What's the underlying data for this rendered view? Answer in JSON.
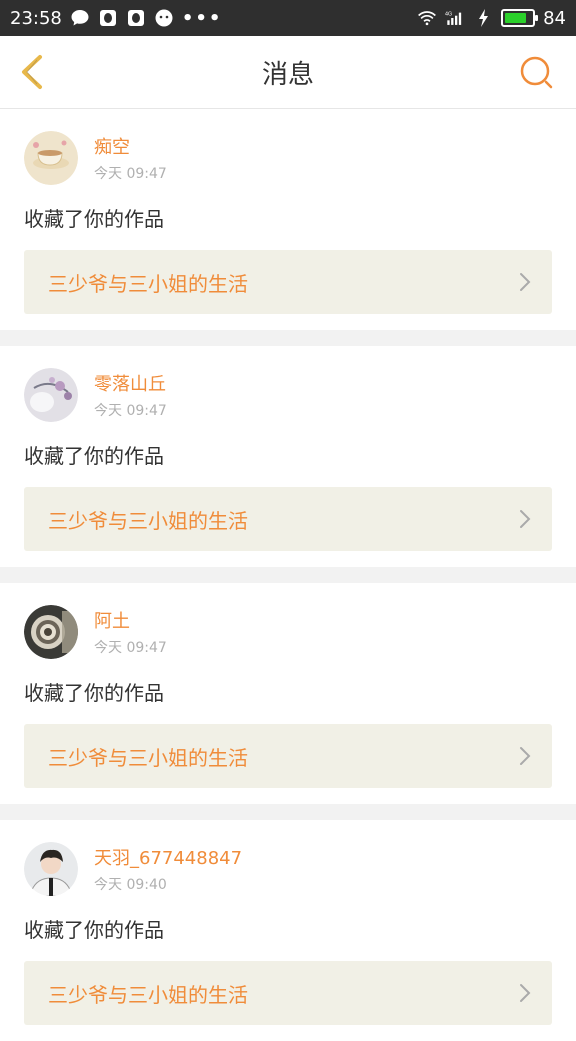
{
  "status_bar": {
    "time": "23:58",
    "battery": "84",
    "battery_level": 0.84,
    "network": "4G"
  },
  "header": {
    "title": "消息"
  },
  "messages": [
    {
      "username": "痴空",
      "time": "今天 09:47",
      "action": "收藏了你的作品",
      "work_title": "三少爷与三小姐的生活",
      "avatar": "teacup-avatar"
    },
    {
      "username": "零落山丘",
      "time": "今天 09:47",
      "action": "收藏了你的作品",
      "work_title": "三少爷与三小姐的生活",
      "avatar": "flower-avatar"
    },
    {
      "username": "阿土",
      "time": "今天 09:47",
      "action": "收藏了你的作品",
      "work_title": "三少爷与三小姐的生活",
      "avatar": "scroll-avatar"
    },
    {
      "username": "天羽_677448847",
      "time": "今天 09:40",
      "action": "收藏了你的作品",
      "work_title": "三少爷与三小姐的生活",
      "avatar": "person-avatar"
    }
  ],
  "colors": {
    "accent": "#f08c3a",
    "back_icon": "#e8b84a",
    "work_bg": "#f1f0e6",
    "status_bar_bg": "#2f2f2f"
  }
}
